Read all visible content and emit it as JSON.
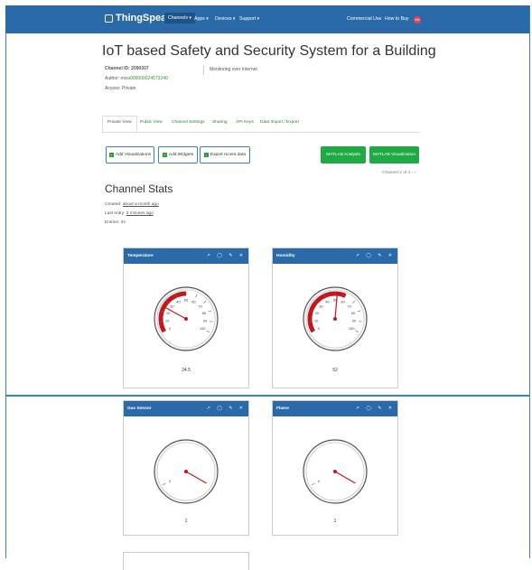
{
  "nav": {
    "brand": "ThingSpeak",
    "trademark": "™",
    "items": [
      "Channels ▾",
      "Apps ▾",
      "Devices ▾",
      "Support ▾"
    ],
    "commercial": "Commercial Use",
    "howto": "How to Buy",
    "avatar": "AA"
  },
  "channel": {
    "title": "IoT based Safety and Security System for a Building",
    "channel_id": "Channel ID: 2090307",
    "author_label": "Author: ",
    "author": "mwa000000024573240",
    "access": "Access: Private",
    "description": "Monitoring over Internet"
  },
  "tabs": [
    "Private View",
    "Public View",
    "Channel Settings",
    "Sharing",
    "API Keys",
    "Data Import / Export"
  ],
  "actions": {
    "add_visualizations": "Add Visualizations",
    "add_widgets": "Add Widgets",
    "export": "Export recent data",
    "matlab_analysis": "MATLAB Analysis",
    "matlab_visualization": "MATLAB Visualization",
    "pager": "Channel 2 of 4  ‹  ›"
  },
  "stats": {
    "title": "Channel Stats",
    "created_label": "Created: ",
    "created": "about a month ago",
    "last_entry_label": "Last entry: ",
    "last_entry": "3 minutes ago",
    "entries": "Entries: 34"
  },
  "widgets": [
    {
      "title": "Temperature",
      "value_text": "24.5",
      "value": 24.5,
      "min": 0,
      "max": 100,
      "red_band": [
        0,
        50
      ],
      "ticks": [
        "0",
        "10",
        "20",
        "30",
        "40",
        "50",
        "60",
        "70",
        "80",
        "90",
        "100"
      ]
    },
    {
      "title": "Humidity",
      "value_text": "52",
      "value": 52,
      "min": 0,
      "max": 100,
      "red_band": [
        0,
        60
      ],
      "ticks": [
        "0",
        "10",
        "20",
        "30",
        "40",
        "50",
        "60",
        "70",
        "80",
        "90",
        "100"
      ]
    },
    {
      "title": "Gas Sensor",
      "value_text": "1",
      "value": 1,
      "min": 0,
      "max": 1,
      "red_band": null,
      "ticks": [
        "0"
      ]
    },
    {
      "title": "Flame",
      "value_text": "1",
      "value": 1,
      "min": 0,
      "max": 1,
      "red_band": null,
      "ticks": [
        "0"
      ]
    }
  ],
  "card_icons": "↗ ◯ ✎ ✕",
  "colors": {
    "nav": "#2b6aa8",
    "green": "#1faa44",
    "gauge_red": "#c6161c"
  }
}
